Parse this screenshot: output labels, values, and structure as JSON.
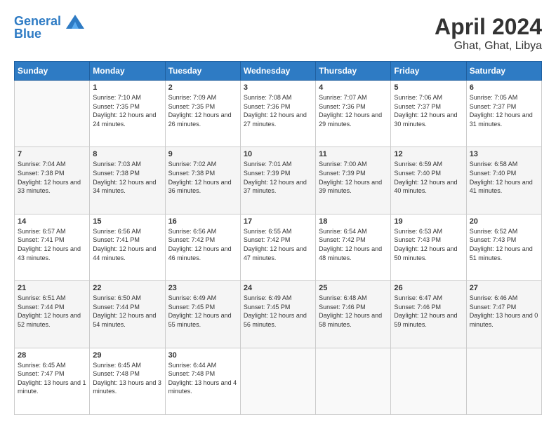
{
  "header": {
    "logo_line1": "General",
    "logo_line2": "Blue",
    "month": "April 2024",
    "location": "Ghat, Ghat, Libya"
  },
  "days_of_week": [
    "Sunday",
    "Monday",
    "Tuesday",
    "Wednesday",
    "Thursday",
    "Friday",
    "Saturday"
  ],
  "weeks": [
    [
      {
        "num": "",
        "sunrise": "",
        "sunset": "",
        "daylight": "",
        "empty": true
      },
      {
        "num": "1",
        "sunrise": "Sunrise: 7:10 AM",
        "sunset": "Sunset: 7:35 PM",
        "daylight": "Daylight: 12 hours and 24 minutes."
      },
      {
        "num": "2",
        "sunrise": "Sunrise: 7:09 AM",
        "sunset": "Sunset: 7:35 PM",
        "daylight": "Daylight: 12 hours and 26 minutes."
      },
      {
        "num": "3",
        "sunrise": "Sunrise: 7:08 AM",
        "sunset": "Sunset: 7:36 PM",
        "daylight": "Daylight: 12 hours and 27 minutes."
      },
      {
        "num": "4",
        "sunrise": "Sunrise: 7:07 AM",
        "sunset": "Sunset: 7:36 PM",
        "daylight": "Daylight: 12 hours and 29 minutes."
      },
      {
        "num": "5",
        "sunrise": "Sunrise: 7:06 AM",
        "sunset": "Sunset: 7:37 PM",
        "daylight": "Daylight: 12 hours and 30 minutes."
      },
      {
        "num": "6",
        "sunrise": "Sunrise: 7:05 AM",
        "sunset": "Sunset: 7:37 PM",
        "daylight": "Daylight: 12 hours and 31 minutes."
      }
    ],
    [
      {
        "num": "7",
        "sunrise": "Sunrise: 7:04 AM",
        "sunset": "Sunset: 7:38 PM",
        "daylight": "Daylight: 12 hours and 33 minutes."
      },
      {
        "num": "8",
        "sunrise": "Sunrise: 7:03 AM",
        "sunset": "Sunset: 7:38 PM",
        "daylight": "Daylight: 12 hours and 34 minutes."
      },
      {
        "num": "9",
        "sunrise": "Sunrise: 7:02 AM",
        "sunset": "Sunset: 7:38 PM",
        "daylight": "Daylight: 12 hours and 36 minutes."
      },
      {
        "num": "10",
        "sunrise": "Sunrise: 7:01 AM",
        "sunset": "Sunset: 7:39 PM",
        "daylight": "Daylight: 12 hours and 37 minutes."
      },
      {
        "num": "11",
        "sunrise": "Sunrise: 7:00 AM",
        "sunset": "Sunset: 7:39 PM",
        "daylight": "Daylight: 12 hours and 39 minutes."
      },
      {
        "num": "12",
        "sunrise": "Sunrise: 6:59 AM",
        "sunset": "Sunset: 7:40 PM",
        "daylight": "Daylight: 12 hours and 40 minutes."
      },
      {
        "num": "13",
        "sunrise": "Sunrise: 6:58 AM",
        "sunset": "Sunset: 7:40 PM",
        "daylight": "Daylight: 12 hours and 41 minutes."
      }
    ],
    [
      {
        "num": "14",
        "sunrise": "Sunrise: 6:57 AM",
        "sunset": "Sunset: 7:41 PM",
        "daylight": "Daylight: 12 hours and 43 minutes."
      },
      {
        "num": "15",
        "sunrise": "Sunrise: 6:56 AM",
        "sunset": "Sunset: 7:41 PM",
        "daylight": "Daylight: 12 hours and 44 minutes."
      },
      {
        "num": "16",
        "sunrise": "Sunrise: 6:56 AM",
        "sunset": "Sunset: 7:42 PM",
        "daylight": "Daylight: 12 hours and 46 minutes."
      },
      {
        "num": "17",
        "sunrise": "Sunrise: 6:55 AM",
        "sunset": "Sunset: 7:42 PM",
        "daylight": "Daylight: 12 hours and 47 minutes."
      },
      {
        "num": "18",
        "sunrise": "Sunrise: 6:54 AM",
        "sunset": "Sunset: 7:42 PM",
        "daylight": "Daylight: 12 hours and 48 minutes."
      },
      {
        "num": "19",
        "sunrise": "Sunrise: 6:53 AM",
        "sunset": "Sunset: 7:43 PM",
        "daylight": "Daylight: 12 hours and 50 minutes."
      },
      {
        "num": "20",
        "sunrise": "Sunrise: 6:52 AM",
        "sunset": "Sunset: 7:43 PM",
        "daylight": "Daylight: 12 hours and 51 minutes."
      }
    ],
    [
      {
        "num": "21",
        "sunrise": "Sunrise: 6:51 AM",
        "sunset": "Sunset: 7:44 PM",
        "daylight": "Daylight: 12 hours and 52 minutes."
      },
      {
        "num": "22",
        "sunrise": "Sunrise: 6:50 AM",
        "sunset": "Sunset: 7:44 PM",
        "daylight": "Daylight: 12 hours and 54 minutes."
      },
      {
        "num": "23",
        "sunrise": "Sunrise: 6:49 AM",
        "sunset": "Sunset: 7:45 PM",
        "daylight": "Daylight: 12 hours and 55 minutes."
      },
      {
        "num": "24",
        "sunrise": "Sunrise: 6:49 AM",
        "sunset": "Sunset: 7:45 PM",
        "daylight": "Daylight: 12 hours and 56 minutes."
      },
      {
        "num": "25",
        "sunrise": "Sunrise: 6:48 AM",
        "sunset": "Sunset: 7:46 PM",
        "daylight": "Daylight: 12 hours and 58 minutes."
      },
      {
        "num": "26",
        "sunrise": "Sunrise: 6:47 AM",
        "sunset": "Sunset: 7:46 PM",
        "daylight": "Daylight: 12 hours and 59 minutes."
      },
      {
        "num": "27",
        "sunrise": "Sunrise: 6:46 AM",
        "sunset": "Sunset: 7:47 PM",
        "daylight": "Daylight: 13 hours and 0 minutes."
      }
    ],
    [
      {
        "num": "28",
        "sunrise": "Sunrise: 6:45 AM",
        "sunset": "Sunset: 7:47 PM",
        "daylight": "Daylight: 13 hours and 1 minute."
      },
      {
        "num": "29",
        "sunrise": "Sunrise: 6:45 AM",
        "sunset": "Sunset: 7:48 PM",
        "daylight": "Daylight: 13 hours and 3 minutes."
      },
      {
        "num": "30",
        "sunrise": "Sunrise: 6:44 AM",
        "sunset": "Sunset: 7:48 PM",
        "daylight": "Daylight: 13 hours and 4 minutes."
      },
      {
        "num": "",
        "sunrise": "",
        "sunset": "",
        "daylight": "",
        "empty": true
      },
      {
        "num": "",
        "sunrise": "",
        "sunset": "",
        "daylight": "",
        "empty": true
      },
      {
        "num": "",
        "sunrise": "",
        "sunset": "",
        "daylight": "",
        "empty": true
      },
      {
        "num": "",
        "sunrise": "",
        "sunset": "",
        "daylight": "",
        "empty": true
      }
    ]
  ]
}
